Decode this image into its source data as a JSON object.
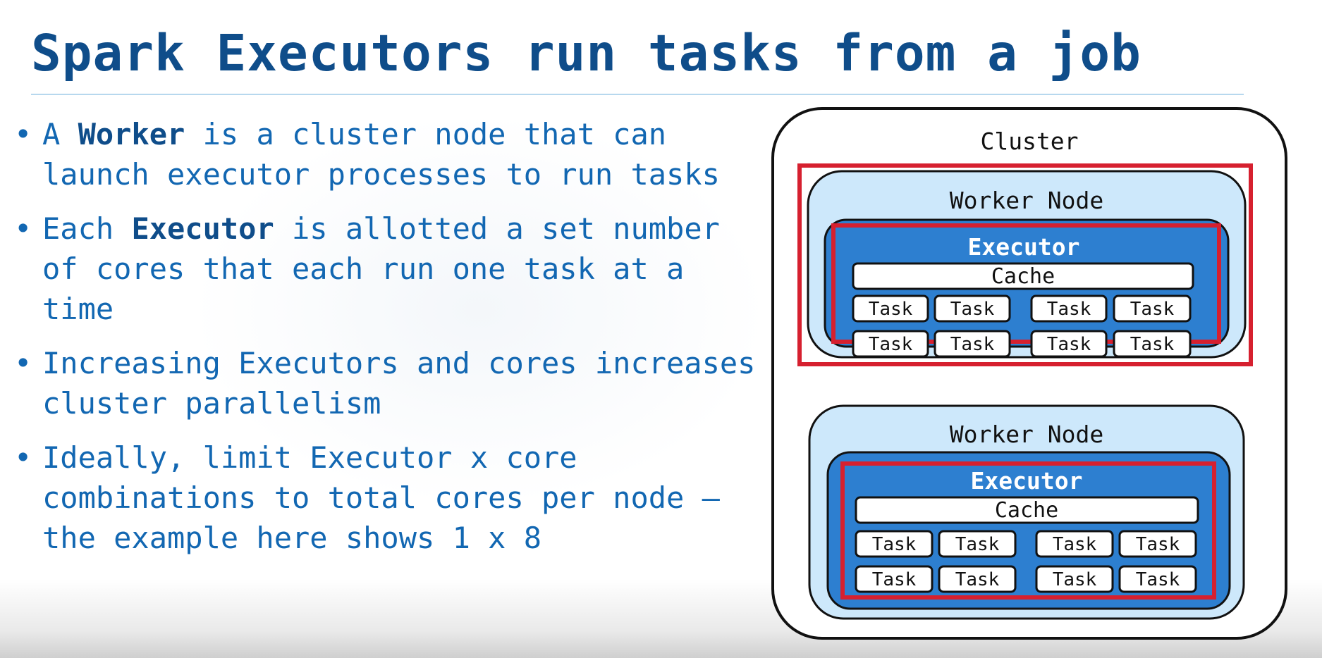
{
  "title": "Spark Executors run tasks from a job",
  "bullets": [
    {
      "parts": [
        "A ",
        "Worker",
        " is a cluster node that can launch executor processes to run tasks"
      ],
      "bold": [
        false,
        true,
        false
      ]
    },
    {
      "parts": [
        "Each ",
        "Executor",
        " is allotted a set number of cores that each run one task at a time"
      ],
      "bold": [
        false,
        true,
        false
      ]
    },
    {
      "parts": [
        "Increasing Executors and cores increases cluster parallelism"
      ],
      "bold": [
        false
      ]
    },
    {
      "parts": [
        "Ideally, limit Executor x core combinations to total cores per node – the example here shows 1 x 8"
      ],
      "bold": [
        false
      ]
    }
  ],
  "diagram": {
    "cluster_label": "Cluster",
    "nodes": [
      {
        "label": "Worker Node",
        "executor_label": "Executor",
        "cache_label": "Cache",
        "tasks": [
          "Task",
          "Task",
          "Task",
          "Task",
          "Task",
          "Task",
          "Task",
          "Task"
        ],
        "highlighted": true
      },
      {
        "label": "Worker Node",
        "executor_label": "Executor",
        "cache_label": "Cache",
        "tasks": [
          "Task",
          "Task",
          "Task",
          "Task",
          "Task",
          "Task",
          "Task",
          "Task"
        ],
        "highlighted": false
      }
    ]
  },
  "colors": {
    "title": "#0f4d8a",
    "text": "#1267b2",
    "worker_fill": "#cde8fb",
    "executor_fill": "#2d7fd0",
    "highlight": "#d6202f"
  }
}
